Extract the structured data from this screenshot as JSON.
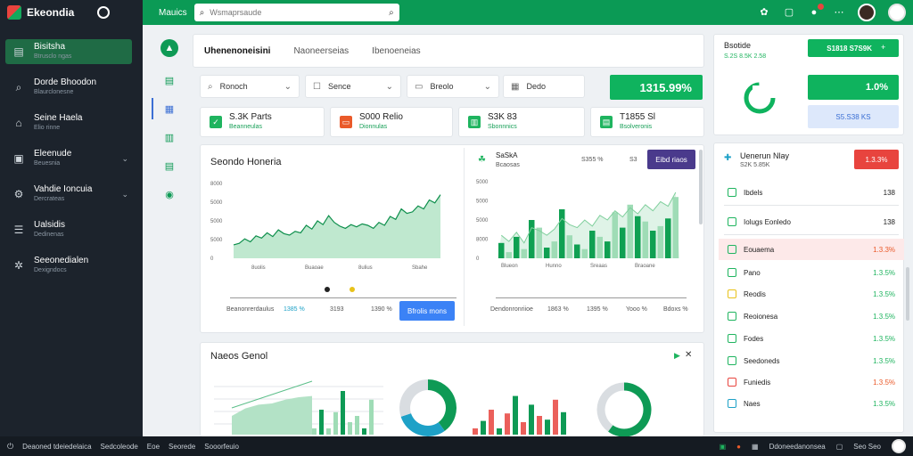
{
  "app": {
    "title": "Ekeondia"
  },
  "topbar": {
    "menu_label": "Mauics",
    "search_placeholder": "Wsmaprsaude"
  },
  "sidebar": {
    "items": [
      {
        "label": "Bisitsha",
        "sub": "Btrusclo ngas",
        "icon": "dashboard-icon"
      },
      {
        "label": "Dorde Bhoodon",
        "sub": "Blaurclonesne",
        "icon": "search-icon"
      },
      {
        "label": "Seine Haela",
        "sub": "Elio rinne",
        "icon": "home-icon"
      },
      {
        "label": "Eleenude",
        "sub": "Beuesnia",
        "icon": "image-icon"
      },
      {
        "label": "Vahdie Ioncuia",
        "sub": "Dercrateas",
        "icon": "gear-icon"
      },
      {
        "label": "Ualsidis",
        "sub": "Dedinenas",
        "icon": "list-icon"
      },
      {
        "label": "Seeonedialen",
        "sub": "Dexigndocs",
        "icon": "users-icon"
      }
    ]
  },
  "tabs": [
    "Uhenenoneisini",
    "Naoneerseias",
    "Ibenoeneias"
  ],
  "filters": [
    "Ronoch",
    "Sence",
    "Breolo",
    "Dedo"
  ],
  "headline_value": "1315.99%",
  "kpis": [
    {
      "value": "S.3K Parts",
      "sub": "Beanneulas",
      "color": "#1fb45f"
    },
    {
      "value": "S000 Relio",
      "sub": "Dionnulas",
      "color": "#ea5a2a"
    },
    {
      "value": "S3K 83",
      "sub": "Sbonnnics",
      "color": "#1fb45f"
    },
    {
      "value": "T1855 Sl",
      "sub": "Bsolveronis",
      "color": "#1fb45f"
    }
  ],
  "chart_left": {
    "title": "Seondo Honeria",
    "footer": [
      "Beanonrerdaulus",
      "1385 %",
      "3193",
      "1390 %"
    ],
    "button_label": "Bfrolis mons",
    "chart_data": {
      "type": "area",
      "yticks": [
        "8000",
        "5000",
        "5000",
        "5000",
        "0"
      ],
      "xticks": [
        "8uolis",
        "Buaoae",
        "8ulius",
        "Sbahe"
      ],
      "values": [
        18,
        20,
        26,
        22,
        30,
        27,
        34,
        29,
        38,
        33,
        31,
        36,
        34,
        44,
        39,
        50,
        45,
        57,
        48,
        43,
        40,
        45,
        42,
        46,
        44,
        40,
        48,
        44,
        56,
        52,
        66,
        60,
        62,
        70,
        66,
        78,
        74,
        85
      ],
      "ylim": [
        0,
        100
      ]
    }
  },
  "chart_right": {
    "title": "SaSkA",
    "subtitle": "Bcaosas",
    "meta": [
      "S355 %",
      "S3"
    ],
    "button_label": "Eibd riaos",
    "footer": [
      "Dendonronriioe",
      "1863 %",
      "1395 %",
      "Yooo %",
      "Bdoxs %"
    ],
    "chart_data": {
      "type": "bar",
      "yticks": [
        "5000",
        "5000",
        "5000",
        "8000",
        "0"
      ],
      "xticks": [
        "Blueon",
        "Hunno",
        "Sreaas",
        "Braoane"
      ],
      "values": [
        20,
        8,
        28,
        12,
        50,
        40,
        14,
        22,
        64,
        30,
        18,
        12,
        36,
        28,
        22,
        60,
        40,
        70,
        55,
        48,
        36,
        42,
        52,
        80
      ],
      "line": [
        30,
        22,
        34,
        20,
        40,
        36,
        30,
        38,
        52,
        44,
        40,
        50,
        42,
        56,
        50,
        62,
        54,
        66,
        58,
        70,
        62,
        74,
        68,
        86
      ],
      "ylim": [
        0,
        100
      ]
    }
  },
  "bottom_panel": {
    "title": "Naeos Genol",
    "chart_data": {
      "type": "bar",
      "area_values": [
        30,
        42,
        48,
        50,
        56,
        60,
        62
      ],
      "bars_a": [
        10,
        40,
        10,
        36,
        70,
        20,
        30,
        10,
        56
      ],
      "bars_b": [
        10,
        22,
        40,
        10,
        34,
        62,
        20,
        48,
        30,
        24,
        56,
        36
      ],
      "donut_a": [
        40,
        30,
        30
      ],
      "donut_b": [
        60,
        40
      ]
    }
  },
  "right_panel": {
    "title": "Bsotide",
    "sub": "S.2S 8.5K 2.58",
    "btn1": "S1818 S7S9K",
    "stat1": "1.0%",
    "stat2": "S5.S38 KS",
    "list_title": "Uenerun Nlay",
    "list_sub": "S2K 5.85K",
    "list_badge": "1.3.3%",
    "rows": [
      {
        "label": "Ibdels",
        "value": "138",
        "icon_color": "#1fb45f"
      },
      {
        "label": "Iolugs Eonledo",
        "value": "138",
        "icon_color": "#1fb45f"
      },
      {
        "label": "Eouaema",
        "value": "1.3.3%",
        "icon_color": "#1fb45f",
        "highlight": true
      },
      {
        "label": "Pano",
        "value": "1.3.5%",
        "icon_color": "#1fb45f"
      },
      {
        "label": "Reodis",
        "value": "1.3.5%",
        "icon_color": "#e8c21a"
      },
      {
        "label": "Reoionesa",
        "value": "1.3.5%",
        "icon_color": "#1fb45f"
      },
      {
        "label": "Fodes",
        "value": "1.3.5%",
        "icon_color": "#1fb45f"
      },
      {
        "label": "Seedoneds",
        "value": "1.3.5%",
        "icon_color": "#1fb45f"
      },
      {
        "label": "Funiedis",
        "value": "1.3.5%",
        "icon_color": "#e8443e"
      },
      {
        "label": "Naes",
        "value": "1.3.5%",
        "icon_color": "#1ea1c7"
      }
    ]
  },
  "bottombar": {
    "left": [
      "Deaoned tdeiedelaica",
      "Sedcoleode",
      "Eoe",
      "Seorede",
      "Sooorfeuio"
    ],
    "right": [
      "Ddoneedanonsea",
      "Seo Seo"
    ]
  },
  "colors": {
    "brand": "#0b9a55",
    "accent": "#0fb35e",
    "sidebar": "#1c232c",
    "danger": "#e8443e"
  }
}
